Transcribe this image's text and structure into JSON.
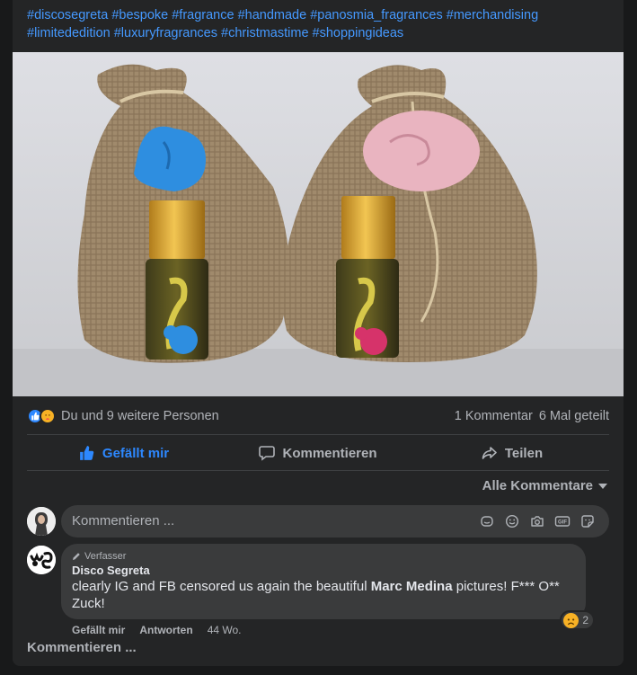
{
  "post": {
    "hashtags": [
      "#discosegreta",
      "#bespoke",
      "#fragrance",
      "#handmade",
      "#panosmia_fragrances",
      "#merchandising",
      "#limitededition",
      "#luxuryfragrances",
      "#christmastime",
      "#shoppingideas"
    ]
  },
  "reactions": {
    "icons": [
      "like-icon",
      "care-icon"
    ],
    "summary": "Du und 9 weitere Personen",
    "comments": "1 Kommentar",
    "shares": "6 Mal geteilt"
  },
  "actions": {
    "like": "Gefällt mir",
    "comment": "Kommentieren",
    "share": "Teilen"
  },
  "comments_filter": "Alle Kommentare",
  "composer": {
    "placeholder": "Kommentieren ...",
    "tools": [
      "sticker-icon",
      "emoji-icon",
      "camera-icon",
      "gif-icon",
      "sticker-face-icon"
    ]
  },
  "comment": {
    "badge": "Verfasser",
    "author": "Disco Segreta",
    "text_before": "clearly IG and FB censored us again the beautiful ",
    "mention": "Marc Medina",
    "text_after": " pictures! F*** O** Zuck!",
    "reaction_count": "2",
    "like_label": "Gefällt mir",
    "reply_label": "Antworten",
    "time": "44 Wo."
  },
  "more_comments": "Kommentieren ...",
  "colors": {
    "background": "#18191a",
    "card": "#242526",
    "input": "#3a3b3c",
    "accent": "#2d88ff",
    "link": "#4599ff",
    "secondary_text": "#b0b3b8"
  }
}
